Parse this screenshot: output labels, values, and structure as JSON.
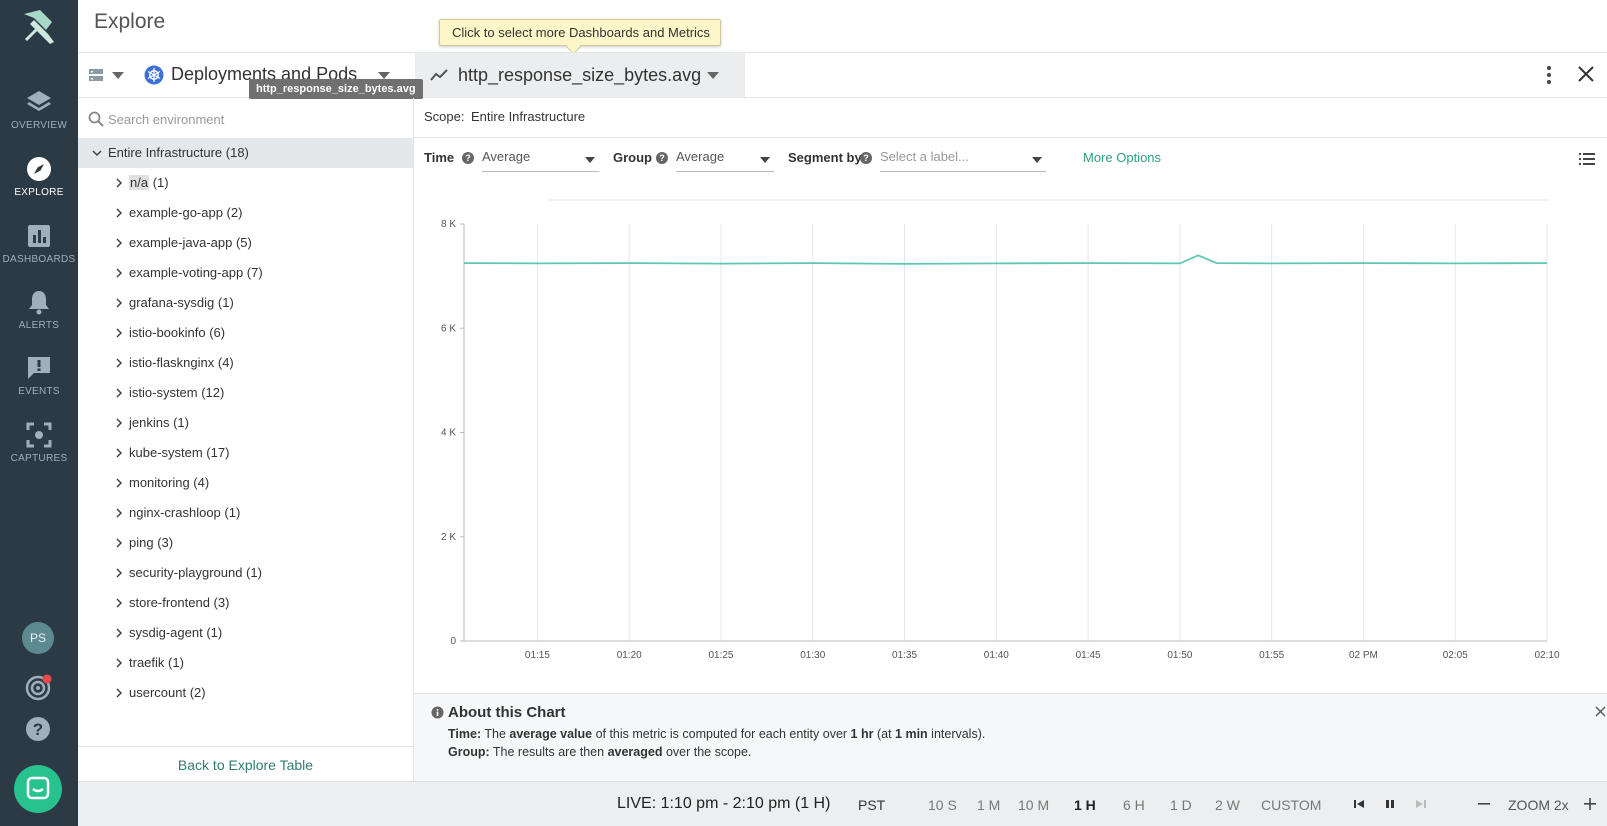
{
  "page": {
    "title": "Explore"
  },
  "tooltip": {
    "text": "Click to select more Dashboards and Metrics"
  },
  "nav": {
    "items": [
      {
        "label": "OVERVIEW",
        "icon": "layers-icon"
      },
      {
        "label": "EXPLORE",
        "icon": "compass-icon",
        "active": true
      },
      {
        "label": "DASHBOARDS",
        "icon": "bar-chart-icon"
      },
      {
        "label": "ALERTS",
        "icon": "bell-icon"
      },
      {
        "label": "EVENTS",
        "icon": "alert-speech-icon"
      },
      {
        "label": "CAPTURES",
        "icon": "capture-frame-icon"
      }
    ],
    "avatar_initials": "PS"
  },
  "topbar": {
    "grouping_label": "Deployments and Pods",
    "metric_label": "http_response_size_bytes.avg",
    "metric_hover_tip": "http_response_size_bytes.avg"
  },
  "tree": {
    "search_placeholder": "Search environment",
    "root": {
      "label": "Entire Infrastructure (18)"
    },
    "items": [
      {
        "name": "n/a",
        "count": " (1)"
      },
      {
        "label": "example-go-app (2)"
      },
      {
        "label": "example-java-app (5)"
      },
      {
        "label": "example-voting-app (7)"
      },
      {
        "label": "grafana-sysdig (1)"
      },
      {
        "label": "istio-bookinfo (6)"
      },
      {
        "label": "istio-flasknginx (4)"
      },
      {
        "label": "istio-system (12)"
      },
      {
        "label": "jenkins (1)"
      },
      {
        "label": "kube-system (17)"
      },
      {
        "label": "monitoring (4)"
      },
      {
        "label": "nginx-crashloop (1)"
      },
      {
        "label": "ping (3)"
      },
      {
        "label": "security-playground (1)"
      },
      {
        "label": "store-frontend (3)"
      },
      {
        "label": "sysdig-agent (1)"
      },
      {
        "label": "traefik (1)"
      },
      {
        "label": "usercount (2)"
      }
    ],
    "back_link": "Back to Explore Table"
  },
  "scope": {
    "key": "Scope:",
    "value": "Entire Infrastructure"
  },
  "controls": {
    "time_label": "Time",
    "time_value": "Average",
    "group_label": "Group",
    "group_value": "Average",
    "segment_label": "Segment by",
    "segment_placeholder": "Select a label...",
    "more_options": "More Options"
  },
  "chart_data": {
    "type": "line",
    "title": "",
    "xlabel": "",
    "ylabel": "",
    "ylim": [
      0,
      8000
    ],
    "y_ticks": [
      {
        "value": 0,
        "label": "0"
      },
      {
        "value": 2000,
        "label": "2 K"
      },
      {
        "value": 4000,
        "label": "4 K"
      },
      {
        "value": 6000,
        "label": "6 K"
      },
      {
        "value": 8000,
        "label": "8 K"
      }
    ],
    "x_ticks": [
      "01:15",
      "01:20",
      "01:25",
      "01:30",
      "01:35",
      "01:40",
      "01:45",
      "01:50",
      "01:55",
      "02 PM",
      "02:05",
      "02:10"
    ],
    "grid": "vertical",
    "color": "#5cc8b0",
    "series": [
      {
        "x": [
          "01:11",
          "01:15",
          "01:20",
          "01:25",
          "01:30",
          "01:35",
          "01:40",
          "01:45",
          "01:50",
          "01:51",
          "01:52",
          "01:55",
          "02 PM",
          "02:05",
          "02:10"
        ],
        "values": [
          7250,
          7245,
          7250,
          7240,
          7250,
          7235,
          7245,
          7250,
          7245,
          7400,
          7250,
          7245,
          7250,
          7245,
          7250
        ]
      }
    ]
  },
  "about": {
    "title": "About this Chart",
    "time_key": "Time:",
    "time_pre": " The ",
    "time_b1": "average value",
    "time_mid": " of this metric is computed for each entity over ",
    "time_b2": "1 hr",
    "time_mid2": " (at ",
    "time_b3": "1 min",
    "time_post": " intervals).",
    "group_key": "Group:",
    "group_pre": " The results are then ",
    "group_b": "averaged",
    "group_post": " over the scope."
  },
  "timebar": {
    "live": "LIVE: 1:10 pm - 2:10 pm (1 H)",
    "tz": "PST",
    "ranges": [
      "10 S",
      "1 M",
      "10 M",
      "1 H",
      "6 H",
      "1 D",
      "2 W",
      "CUSTOM"
    ],
    "active_range": "1 H",
    "zoom": "ZOOM 2x"
  }
}
